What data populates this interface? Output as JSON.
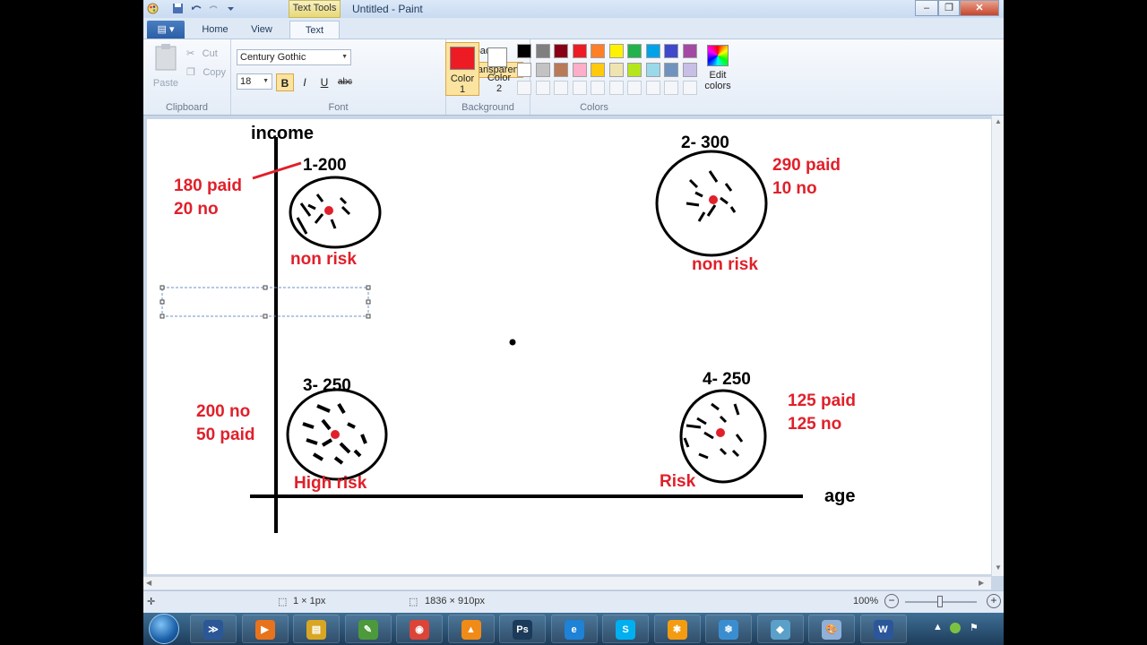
{
  "window": {
    "title": "Untitled - Paint",
    "contextual_tab": "Text Tools",
    "controls": {
      "minimize": "–",
      "restore": "❐",
      "close": "✕"
    }
  },
  "tabs": {
    "home": "Home",
    "view": "View",
    "text": "Text"
  },
  "ribbon": {
    "clipboard": {
      "paste": "Paste",
      "cut": "Cut",
      "copy": "Copy",
      "label": "Clipboard"
    },
    "font": {
      "family": "Century Gothic",
      "size": "18",
      "bold": "B",
      "italic": "I",
      "underline": "U",
      "strike": "abc",
      "label": "Font"
    },
    "background": {
      "opaque": "Opaque",
      "transparent": "Transparent",
      "label": "Background"
    },
    "colors": {
      "color1_label_1": "Color",
      "color1_label_2": "1",
      "color2_label_1": "Color",
      "color2_label_2": "2",
      "edit_1": "Edit",
      "edit_2": "colors",
      "label": "Colors",
      "color1": "#ed1c24",
      "color2": "#ffffff",
      "palette_row1": [
        "#000000",
        "#7f7f7f",
        "#880015",
        "#ed1c24",
        "#ff7f27",
        "#fff200",
        "#22b14c",
        "#00a2e8",
        "#3f48cc",
        "#a349a4"
      ],
      "palette_row2": [
        "#ffffff",
        "#c3c3c3",
        "#b97a57",
        "#ffaec9",
        "#ffc90e",
        "#efe4b0",
        "#b5e61d",
        "#99d9ea",
        "#7092be",
        "#c8bfe7"
      ]
    }
  },
  "canvas_text": {
    "y_axis": "income",
    "x_axis": "age",
    "q1_title": "1-200",
    "q1_paid": "180 paid",
    "q1_no": "20 no",
    "q1_risk": "non risk",
    "q2_title": "2- 300",
    "q2_paid": "290 paid",
    "q2_no": "10 no",
    "q2_risk": "non risk",
    "q3_title": "3- 250",
    "q3_no": "200 no",
    "q3_paid": "50 paid",
    "q3_risk": "High risk",
    "q4_title": "4- 250",
    "q4_paid": "125 paid",
    "q4_no": "125 no",
    "q4_risk": "Risk",
    "ink_black": "#000000",
    "ink_red": "#e0202a"
  },
  "status": {
    "selection": "1 × 1px",
    "size": "1836 × 910px",
    "zoom": "100%"
  },
  "taskbar": {
    "apps": [
      {
        "name": "powershell",
        "glyph": "≫",
        "color": "#2b5797"
      },
      {
        "name": "media-player",
        "glyph": "▶",
        "color": "#e8731d"
      },
      {
        "name": "file-explorer",
        "glyph": "▤",
        "color": "#d9a623"
      },
      {
        "name": "notepad",
        "glyph": "✎",
        "color": "#4c9a3b"
      },
      {
        "name": "chrome",
        "glyph": "◉",
        "color": "#db4437"
      },
      {
        "name": "vlc",
        "glyph": "▲",
        "color": "#f08b17"
      },
      {
        "name": "photoshop",
        "glyph": "Ps",
        "color": "#1c3a59"
      },
      {
        "name": "internet-explorer",
        "glyph": "e",
        "color": "#1e82d6"
      },
      {
        "name": "skype",
        "glyph": "S",
        "color": "#00aff0"
      },
      {
        "name": "snowflake-app",
        "glyph": "✱",
        "color": "#f39c12"
      },
      {
        "name": "snow-app",
        "glyph": "❄",
        "color": "#3a8ed0"
      },
      {
        "name": "pen-app",
        "glyph": "◆",
        "color": "#5aa0c8"
      },
      {
        "name": "paint",
        "glyph": "🎨",
        "color": "#8fb0d8"
      },
      {
        "name": "word",
        "glyph": "W",
        "color": "#2b579a"
      }
    ]
  }
}
